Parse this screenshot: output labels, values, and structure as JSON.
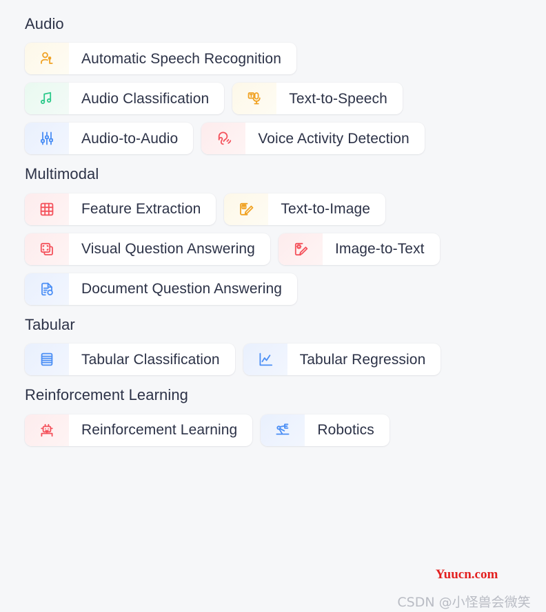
{
  "page": {
    "background_color": "#f6f7f9",
    "text_color": "#2c3247"
  },
  "sections": [
    {
      "title": "Audio",
      "rows": [
        [
          {
            "label": "Automatic Speech Recognition",
            "icon": "speaking-person-icon",
            "color": "#f0a223",
            "tint": "tint-yellow"
          }
        ],
        [
          {
            "label": "Audio Classification",
            "icon": "music-note-icon",
            "color": "#2cc98a",
            "tint": "tint-green"
          },
          {
            "label": "Text-to-Speech",
            "icon": "text-microphone-icon",
            "color": "#f0a223",
            "tint": "tint-yellow"
          }
        ],
        [
          {
            "label": "Audio-to-Audio",
            "icon": "sliders-icon",
            "color": "#4a8ef5",
            "tint": "tint-blue"
          },
          {
            "label": "Voice Activity Detection",
            "icon": "ear-sound-icon",
            "color": "#f4515b",
            "tint": "tint-red"
          }
        ]
      ]
    },
    {
      "title": "Multimodal",
      "rows": [
        [
          {
            "label": "Feature Extraction",
            "icon": "grid-table-icon",
            "color": "#f4515b",
            "tint": "tint-red"
          },
          {
            "label": "Text-to-Image",
            "icon": "text-pencil-icon",
            "color": "#f0a223",
            "tint": "tint-yellow"
          }
        ],
        [
          {
            "label": "Visual Question Answering",
            "icon": "image-crop-icon",
            "color": "#f4515b",
            "tint": "tint-red"
          },
          {
            "label": "Image-to-Text",
            "icon": "image-pencil-icon",
            "color": "#f4515b",
            "tint": "tint-red"
          }
        ],
        [
          {
            "label": "Document Question Answering",
            "icon": "document-search-icon",
            "color": "#4a8ef5",
            "tint": "tint-blue"
          }
        ]
      ]
    },
    {
      "title": "Tabular",
      "rows": [
        [
          {
            "label": "Tabular Classification",
            "icon": "table-rows-icon",
            "color": "#4a8ef5",
            "tint": "tint-blue"
          },
          {
            "label": "Tabular Regression",
            "icon": "line-chart-icon",
            "color": "#4a8ef5",
            "tint": "tint-blue"
          }
        ]
      ]
    },
    {
      "title": "Reinforcement Learning",
      "rows": [
        [
          {
            "label": "Reinforcement Learning",
            "icon": "robot-icon",
            "color": "#f4515b",
            "tint": "tint-red"
          },
          {
            "label": "Robotics",
            "icon": "robot-arm-icon",
            "color": "#4a8ef5",
            "tint": "tint-blue"
          }
        ]
      ]
    }
  ],
  "watermarks": {
    "site": "Yuucn.com",
    "author": "CSDN @小怪兽会微笑"
  }
}
